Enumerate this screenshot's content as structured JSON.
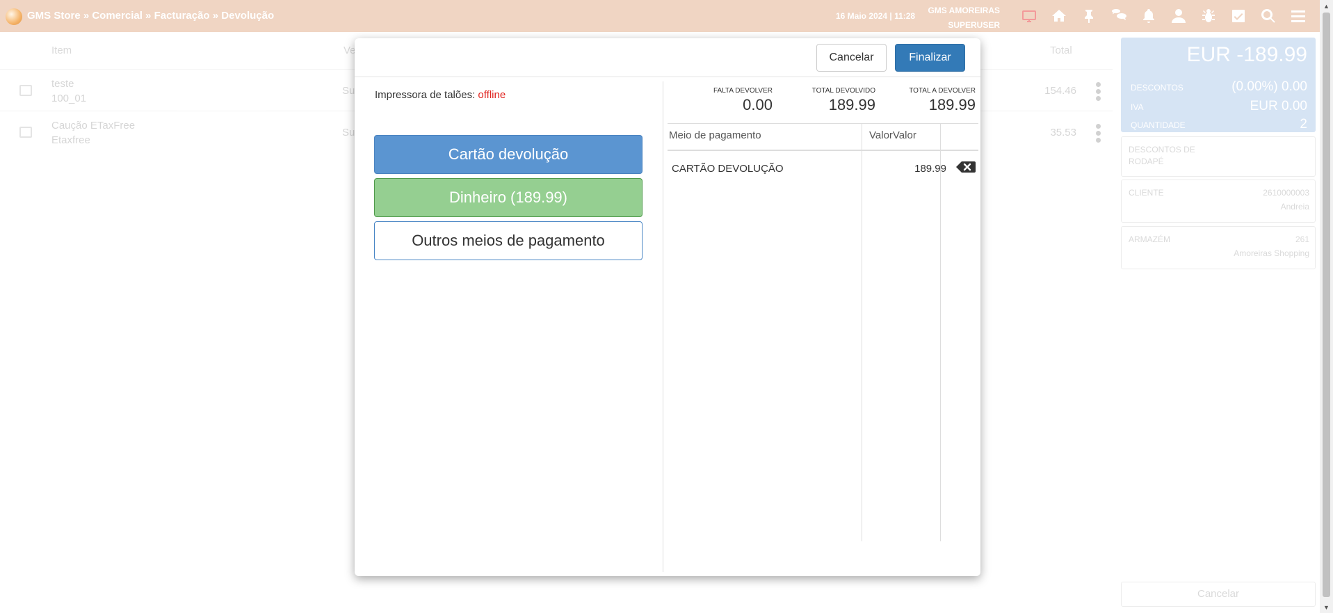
{
  "header": {
    "breadcrumb": "GMS Store » Comercial » Facturação » Devolução",
    "datetime": "16 Maio 2024 | 11:28",
    "store_name": "GMS AMOREIRAS",
    "user": "SUPERUSER"
  },
  "icons": [
    "monitor-icon",
    "home-icon",
    "pin-icon",
    "chat-icon",
    "bell-icon",
    "user-icon",
    "bug-icon",
    "check-icon",
    "search-icon",
    "menu-icon"
  ],
  "background": {
    "columns": {
      "item": "Item",
      "vendor": "Ve",
      "total": "Total"
    },
    "rows": [
      {
        "name": "teste",
        "code": "100_01",
        "vendor": "Su",
        "total": "154.46"
      },
      {
        "name": "Caução ETaxFree",
        "code": "Etaxfree",
        "vendor": "Su",
        "total": "35.53"
      }
    ],
    "summary": {
      "total": "EUR -189.99",
      "discounts_label": "DESCONTOS",
      "discounts_value": "(0.00%) 0.00",
      "vat_label": "IVA",
      "vat_value": "EUR 0.00",
      "qty_label": "QUANTIDADE",
      "qty_value": "2"
    },
    "footer_discounts": "DESCONTOS DE RODAPÉ",
    "client_label": "CLIENTE",
    "client_id": "2610000003",
    "client_name": "Andreia",
    "warehouse_label": "ARMAZÉM",
    "warehouse_id": "261",
    "warehouse_name": "Amoreiras Shopping",
    "cancel": "Cancelar"
  },
  "modal": {
    "cancel_label": "Cancelar",
    "finish_label": "Finalizar",
    "printer_label": "Impressora de talões:",
    "printer_status": "offline",
    "pay_buttons": {
      "card": "Cartão devolução",
      "cash": "Dinheiro (189.99)",
      "other": "Outros meios de pagamento"
    },
    "summary": {
      "missing_label": "FALTA DEVOLVER",
      "missing_value": "0.00",
      "returned_label": "TOTAL DEVOLVIDO",
      "returned_value": "189.99",
      "to_return_label": "TOTAL A DEVOLVER",
      "to_return_value": "189.99"
    },
    "table": {
      "col_method": "Meio de pagamento",
      "col_value": "ValorValor",
      "rows": [
        {
          "method": "CARTÃO DEVOLUÇÃO",
          "value": "189.99"
        }
      ]
    }
  },
  "colors": {
    "topbar": "#f0d5c3",
    "primary": "#337ab7",
    "card_button": "#5b95d1",
    "cash_button": "#95cf91",
    "offline": "#e0201c"
  }
}
